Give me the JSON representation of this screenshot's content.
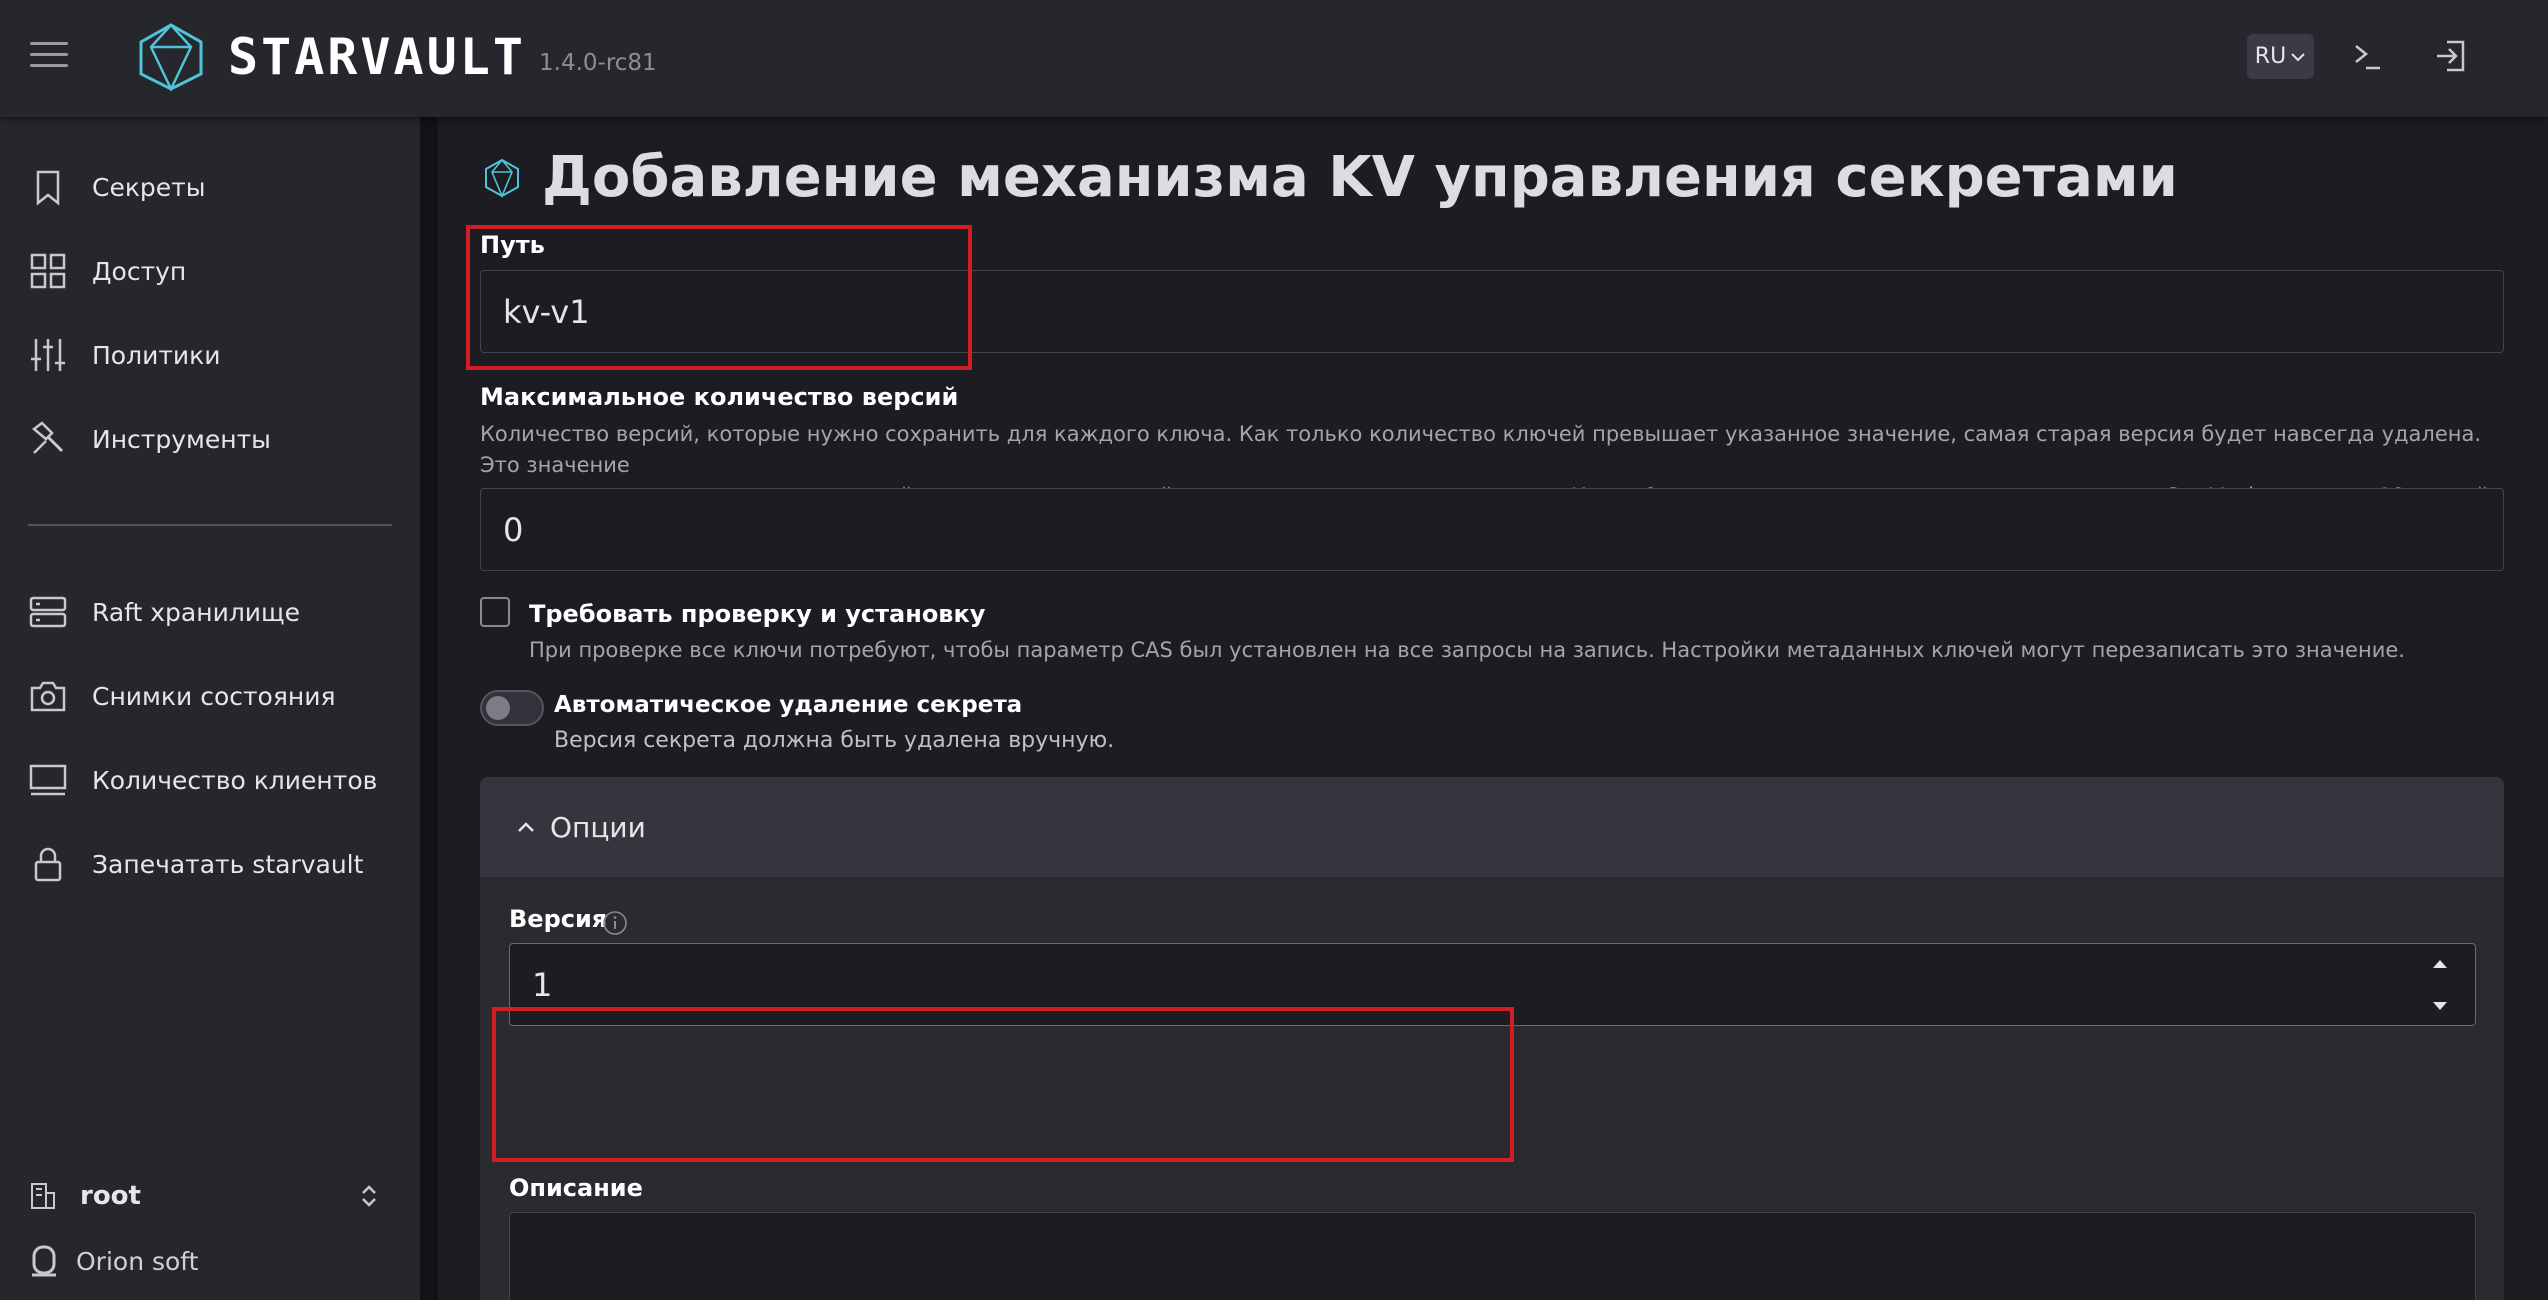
{
  "header": {
    "brand": "STARVAULT",
    "version": "1.4.0-rc81",
    "language": "RU"
  },
  "sidebar": {
    "items": [
      {
        "label": "Секреты",
        "icon": "bookmark-icon"
      },
      {
        "label": "Доступ",
        "icon": "grid-icon"
      },
      {
        "label": "Политики",
        "icon": "sliders-icon"
      },
      {
        "label": "Инструменты",
        "icon": "tools-icon"
      }
    ],
    "items2": [
      {
        "label": "Raft хранилище",
        "icon": "server-icon"
      },
      {
        "label": "Снимки состояния",
        "icon": "camera-icon"
      },
      {
        "label": "Количество клиентов",
        "icon": "monitor-icon"
      },
      {
        "label": "Запечатать starvault",
        "icon": "lock-icon"
      }
    ],
    "namespace": "root",
    "company": "Orion soft"
  },
  "main": {
    "title": "Добавление механизма KV управления секретами",
    "path_label": "Путь",
    "path_value": "kv-v1",
    "max_versions_label": "Максимальное количество версий",
    "max_versions_help_1": "Количество версий, которые нужно сохранить для каждого ключа. Как только количество ключей превышает указанное значение, самая старая версия будет навсегда удалена. Это значение",
    "max_versions_help_2": "относится ко всем ключам, но настройки метаданных ключей могут перезаписать это значение. Когда 0 используется или значение не установлено, StarVault сохранит 10 версий.",
    "max_versions_value": "0",
    "cas_label": "Требовать проверку и установку",
    "cas_help": "При проверке все ключи потребуют, чтобы параметр CAS был установлен на все запросы на запись. Настройки метаданных ключей могут перезаписать это значение.",
    "auto_delete_label": "Автоматическое удаление секрета",
    "auto_delete_help": "Версия секрета должна быть удалена вручную.",
    "options_label": "Опции",
    "kv_version_label": "Версия",
    "kv_version_value": "1",
    "description_label": "Описание"
  },
  "colors": {
    "accent": "#4fc3d9",
    "highlight": "#d11e24",
    "background": "#1c1c22",
    "panel": "#26262d"
  }
}
